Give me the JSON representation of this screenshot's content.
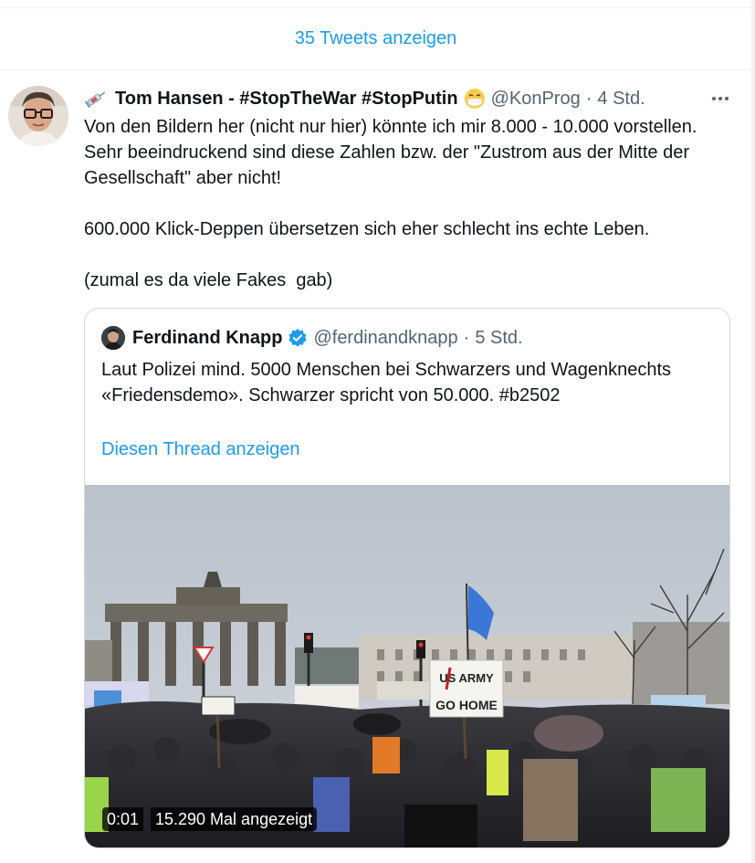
{
  "thread": {
    "show_more_label": "35 Tweets anzeigen"
  },
  "tweet": {
    "author_emoji_left": "syringe",
    "author_name": "Tom Hansen - #StopTheWar #StopPutin",
    "author_emoji_right": "face-with-medical-mask",
    "handle": "@KonProg",
    "separator": "·",
    "time": "4 Std.",
    "paragraphs": [
      "Von den Bildern her (nicht nur hier) könnte ich mir 8.000 - 10.000 vorstellen. Sehr beeindruckend sind diese Zahlen bzw. der \"Zustrom aus der Mitte der Gesellschaft\" aber nicht!",
      "600.000 Klick-Deppen übersetzen sich eher schlecht ins echte Leben.",
      "(zumal es da viele Fakes  gab)"
    ]
  },
  "quote": {
    "author_name": "Ferdinand Knapp",
    "verified": true,
    "handle": "@ferdinandknapp",
    "separator": "·",
    "time": "5 Std.",
    "text": "Laut Polizei mind. 5000 Menschen bei Schwarzers und Wagenknechts «Friedensdemo». Schwarzer spricht von 50.000. #b2502",
    "show_thread_label": "Diesen Thread anzeigen",
    "video": {
      "duration": "0:01",
      "views": "15.290 Mal angezeigt",
      "sign_line1": "US ARMY",
      "sign_line2": "GO HOME"
    }
  },
  "colors": {
    "link": "#1d9bf0",
    "muted": "#536471",
    "border": "#cfd9de",
    "verified": "#1d9bf0"
  }
}
